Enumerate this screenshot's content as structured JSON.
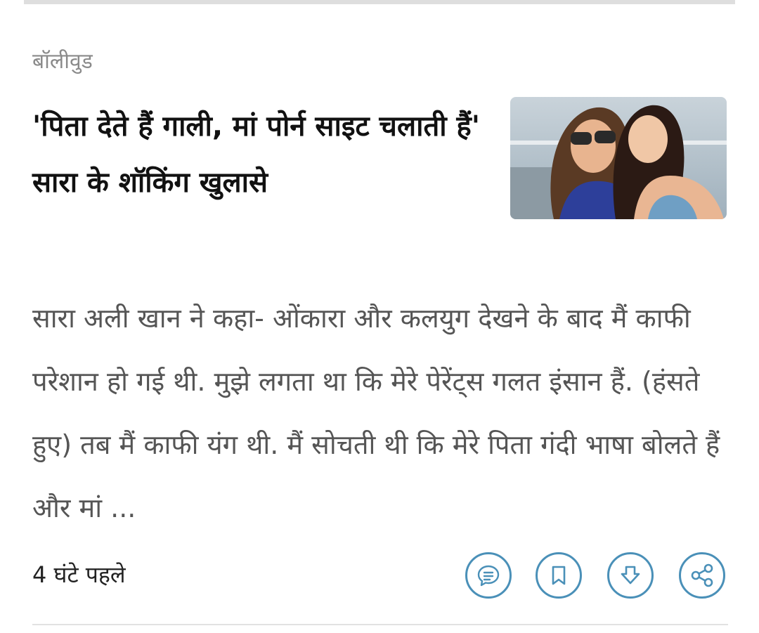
{
  "article": {
    "category": "बॉलीवुड",
    "headline": "'पिता देते हैं गाली, मां पोर्न साइट चलाती हैं' सारा के शॉकिंग खुलासे",
    "summary": "सारा अली खान ने कहा- ओंकारा और कलयुग देखने के बाद मैं काफी परेशान हो गई थी. मुझे लगता था कि मेरे पेरेंट्स गलत इंसान हैं. (हंसते हुए) तब मैं काफी यंग थी. मैं सोचती थी कि मेरे पिता गंदी भाषा बोलते हैं और मां ...",
    "time": "4 घंटे पहले"
  },
  "actions": [
    {
      "name": "comment",
      "icon": "comment-icon"
    },
    {
      "name": "bookmark",
      "icon": "bookmark-icon"
    },
    {
      "name": "download",
      "icon": "download-icon"
    },
    {
      "name": "share",
      "icon": "share-icon"
    }
  ],
  "colors": {
    "accent": "#4a90b8",
    "headline": "#111111",
    "summary": "#555555",
    "category": "#8a8a8a",
    "divider": "#dedede"
  }
}
